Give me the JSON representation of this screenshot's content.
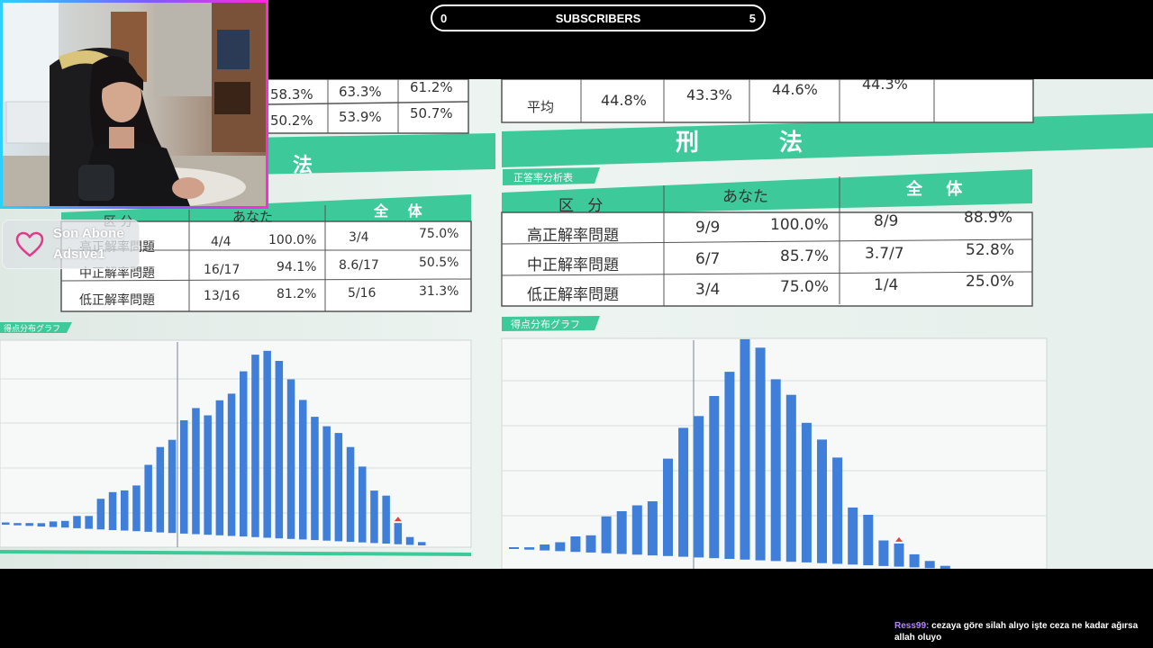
{
  "subscriber_goal": {
    "label": "SUBSCRIBERS",
    "current": "0",
    "target": "5"
  },
  "latest_subscriber": {
    "title": "Son Abone",
    "name": "Adsive1",
    "icon": "heart-icon"
  },
  "chat": {
    "username": "Ress99:",
    "message": "cezaya göre silah alıyo işte ceza ne kadar ağırsa allah oluyo",
    "username_color": "#b585ff"
  },
  "stream_content": {
    "left_section": {
      "title": "法",
      "top_partial_rows": [
        [
          "58.3%",
          "63.3%",
          "61.2%"
        ],
        [
          "50.2%",
          "53.9%",
          "50.7%"
        ]
      ],
      "header": [
        "区 分",
        "あなた",
        "全 体"
      ],
      "rows": [
        [
          "高正解率問題",
          "4/4",
          "100.0%",
          "3/4",
          "75.0%"
        ],
        [
          "中正解率問題",
          "16/17",
          "94.1%",
          "8.6/17",
          "50.5%"
        ],
        [
          "低正解率問題",
          "13/16",
          "81.2%",
          "5/16",
          "31.3%"
        ]
      ],
      "graph_tag": "得点分布グラフ"
    },
    "right_section": {
      "title": "刑 法",
      "top_partial_row": [
        "平均",
        "44.8%",
        "43.3%",
        "44.6%",
        "44.3%"
      ],
      "table_tag": "正答率分析表",
      "header": [
        "区 分",
        "あなた",
        "全 体"
      ],
      "rows": [
        [
          "高正解率問題",
          "9/9",
          "100.0%",
          "8/9",
          "88.9%"
        ],
        [
          "中正解率問題",
          "6/7",
          "85.7%",
          "3.7/7",
          "52.8%"
        ],
        [
          "低正解率問題",
          "3/4",
          "75.0%",
          "1/4",
          "25.0%"
        ]
      ],
      "graph_tag": "得点分布グラフ"
    },
    "colors": {
      "accent_green": "#3dc99a",
      "bar_blue": "#3f7fd9",
      "marker_red": "#e04545"
    }
  },
  "chart_data": [
    {
      "type": "bar",
      "series": [
        {
          "values": [
            0.4,
            0.4,
            0.5,
            0.6,
            1,
            1.2,
            2.2,
            2.3,
            5.5,
            6.8,
            7.2,
            8.2,
            12,
            15.3,
            16.7,
            20.3,
            22.6,
            21.4,
            24.2,
            25.5,
            29.6,
            32.7,
            33.5,
            31.8,
            28.6,
            25,
            22.1,
            20.5,
            19.4,
            17,
            13.6,
            9.4,
            8.6,
            3.8,
            1.4,
            0.6
          ]
        }
      ],
      "marker_index": 33
    },
    {
      "type": "bar",
      "series": [
        {
          "values": [
            0.3,
            0.4,
            1,
            1.5,
            2.6,
            2.9,
            6.2,
            7.2,
            8.3,
            9.1,
            16.4,
            21.7,
            23.8,
            27.3,
            31.5,
            37.1,
            35.8,
            30.6,
            28.1,
            23.5,
            20.8,
            17.9,
            9.6,
            8.5,
            4.3,
            3.9,
            2.2,
            1.2,
            0.5
          ]
        }
      ],
      "marker_index": 25
    }
  ]
}
